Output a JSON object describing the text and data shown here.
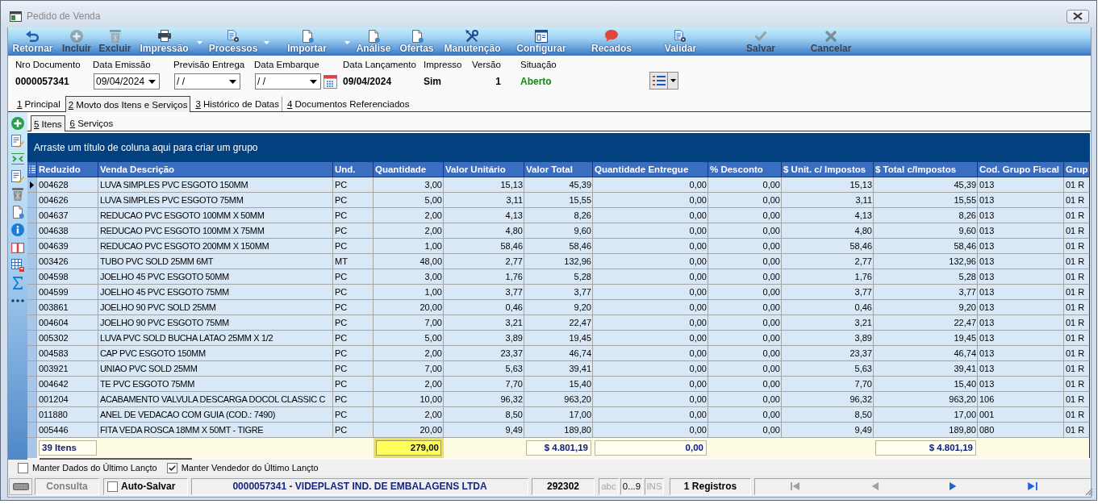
{
  "window": {
    "title": "Pedido de Venda"
  },
  "toolbar": [
    {
      "label": "Retornar",
      "disabled": false,
      "dropdown": false
    },
    {
      "label": "Incluir",
      "disabled": true,
      "dropdown": false
    },
    {
      "label": "Excluir",
      "disabled": true,
      "dropdown": false
    },
    {
      "label": "Impressão",
      "disabled": false,
      "dropdown": true
    },
    {
      "label": "Processos",
      "disabled": false,
      "dropdown": true
    },
    {
      "label": "Importar",
      "disabled": false,
      "dropdown": true
    },
    {
      "label": "Análise",
      "disabled": false,
      "dropdown": false
    },
    {
      "label": "Ofertas",
      "disabled": false,
      "dropdown": false
    },
    {
      "label": "Manutenção",
      "disabled": false,
      "dropdown": false
    },
    {
      "label": "Configurar",
      "disabled": false,
      "dropdown": false
    },
    {
      "label": "Recados",
      "disabled": false,
      "dropdown": false
    },
    {
      "label": "Validar",
      "disabled": false,
      "dropdown": false
    },
    {
      "label": "Salvar",
      "disabled": true,
      "dropdown": false
    },
    {
      "label": "Cancelar",
      "disabled": true,
      "dropdown": false
    }
  ],
  "header": {
    "fields": [
      {
        "kind": "text",
        "label": "Nro Documento",
        "value": "0000057341"
      },
      {
        "kind": "date",
        "label": "Data Emissão",
        "value": "09/04/2024"
      },
      {
        "kind": "date",
        "label": "Previsão Entrega",
        "value": "/ /"
      },
      {
        "kind": "date-calendar",
        "label": "Data Embarque",
        "value": "/ /"
      },
      {
        "kind": "text",
        "label": "Data Lançamento",
        "value": "09/04/2024"
      },
      {
        "kind": "text",
        "label": "Impresso",
        "value": "Sim"
      },
      {
        "kind": "text",
        "label": "Versão",
        "value": "1"
      },
      {
        "kind": "status",
        "label": "Situação",
        "value": "Aberto"
      }
    ]
  },
  "tabs": [
    {
      "label": "1 Principal",
      "selected": false
    },
    {
      "label": "2 Movto dos Itens e Serviços",
      "selected": true
    },
    {
      "label": "3 Histórico de Datas",
      "selected": false
    },
    {
      "label": "4 Documentos Referenciados",
      "selected": false
    }
  ],
  "subtabs": [
    {
      "label": "5 Itens",
      "selected": true
    },
    {
      "label": "6 Serviços",
      "selected": false
    }
  ],
  "grid": {
    "group_hint": "Arraste um título de coluna aqui para criar um grupo",
    "columns": [
      "Reduzido",
      "Venda Descrição",
      "Und.",
      "Quantidade",
      "Valor Unitário",
      "Valor Total",
      "Quantidade Entregue",
      "% Desconto",
      "$ Unit. c/ Impostos",
      "$ Total c/Impostos",
      "Cod. Grupo Fiscal",
      "Grup"
    ],
    "rows": [
      {
        "selected": true,
        "cells": [
          "004628",
          "LUVA SIMPLES PVC ESGOTO 150MM",
          "PC",
          "3,00",
          "15,13",
          "45,39",
          "0,00",
          "0,00",
          "15,13",
          "45,39",
          "013",
          "01 R"
        ]
      },
      {
        "selected": false,
        "cells": [
          "004626",
          "LUVA SIMPLES PVC ESGOTO 75MM",
          "PC",
          "5,00",
          "3,11",
          "15,55",
          "0,00",
          "0,00",
          "3,11",
          "15,55",
          "013",
          "01 R"
        ]
      },
      {
        "selected": false,
        "cells": [
          "004637",
          "REDUCAO PVC ESGOTO 100MM X 50MM",
          "PC",
          "2,00",
          "4,13",
          "8,26",
          "0,00",
          "0,00",
          "4,13",
          "8,26",
          "013",
          "01 R"
        ]
      },
      {
        "selected": false,
        "cells": [
          "004638",
          "REDUCAO PVC ESGOTO 100MM X 75MM",
          "PC",
          "2,00",
          "4,80",
          "9,60",
          "0,00",
          "0,00",
          "4,80",
          "9,60",
          "013",
          "01 R"
        ]
      },
      {
        "selected": false,
        "cells": [
          "004639",
          "REDUCAO PVC ESGOTO 200MM X 150MM",
          "PC",
          "1,00",
          "58,46",
          "58,46",
          "0,00",
          "0,00",
          "58,46",
          "58,46",
          "013",
          "01 R"
        ]
      },
      {
        "selected": false,
        "cells": [
          "003426",
          "TUBO PVC SOLD 25MM 6MT",
          "MT",
          "48,00",
          "2,77",
          "132,96",
          "0,00",
          "0,00",
          "2,77",
          "132,96",
          "013",
          "01 R"
        ]
      },
      {
        "selected": false,
        "cells": [
          "004598",
          "JOELHO 45 PVC ESGOTO 50MM",
          "PC",
          "3,00",
          "1,76",
          "5,28",
          "0,00",
          "0,00",
          "1,76",
          "5,28",
          "013",
          "01 R"
        ]
      },
      {
        "selected": false,
        "cells": [
          "004599",
          "JOELHO 45 PVC ESGOTO 75MM",
          "PC",
          "1,00",
          "3,77",
          "3,77",
          "0,00",
          "0,00",
          "3,77",
          "3,77",
          "013",
          "01 R"
        ]
      },
      {
        "selected": false,
        "cells": [
          "003861",
          "JOELHO 90 PVC SOLD 25MM",
          "PC",
          "20,00",
          "0,46",
          "9,20",
          "0,00",
          "0,00",
          "0,46",
          "9,20",
          "013",
          "01 R"
        ]
      },
      {
        "selected": false,
        "cells": [
          "004604",
          "JOELHO 90 PVC ESGOTO 75MM",
          "PC",
          "7,00",
          "3,21",
          "22,47",
          "0,00",
          "0,00",
          "3,21",
          "22,47",
          "013",
          "01 R"
        ]
      },
      {
        "selected": false,
        "cells": [
          "005302",
          "LUVA PVC SOLD BUCHA LATAO 25MM X 1/2",
          "PC",
          "5,00",
          "3,89",
          "19,45",
          "0,00",
          "0,00",
          "3,89",
          "19,45",
          "013",
          "01 R"
        ]
      },
      {
        "selected": false,
        "cells": [
          "004583",
          "CAP PVC ESGOTO 150MM",
          "PC",
          "2,00",
          "23,37",
          "46,74",
          "0,00",
          "0,00",
          "23,37",
          "46,74",
          "013",
          "01 R"
        ]
      },
      {
        "selected": false,
        "cells": [
          "003921",
          "UNIAO PVC SOLD 25MM",
          "PC",
          "7,00",
          "5,63",
          "39,41",
          "0,00",
          "0,00",
          "5,63",
          "39,41",
          "013",
          "01 R"
        ]
      },
      {
        "selected": false,
        "cells": [
          "004642",
          "TE PVC ESGOTO 75MM",
          "PC",
          "2,00",
          "7,70",
          "15,40",
          "0,00",
          "0,00",
          "7,70",
          "15,40",
          "013",
          "01 R"
        ]
      },
      {
        "selected": false,
        "cells": [
          "001204",
          "ACABAMENTO VALVULA DESCARGA DOCOL CLASSIC C",
          "PC",
          "10,00",
          "96,32",
          "963,20",
          "0,00",
          "0,00",
          "96,32",
          "963,20",
          "106",
          "01 R"
        ]
      },
      {
        "selected": false,
        "cells": [
          "011880",
          "ANEL DE VEDACAO COM GUIA (COD.: 7490)",
          "PC",
          "2,00",
          "8,50",
          "17,00",
          "0,00",
          "0,00",
          "8,50",
          "17,00",
          "001",
          "01 R"
        ]
      },
      {
        "selected": false,
        "cells": [
          "005446",
          "FITA VEDA ROSCA 18MM X 50MT - TIGRE",
          "PC",
          "20,00",
          "9,49",
          "189,80",
          "0,00",
          "0,00",
          "9,49",
          "189,80",
          "080",
          "01 R"
        ]
      }
    ],
    "totals": [
      {
        "text": "39 Itens",
        "highlighted": false
      },
      {
        "text": "279,00",
        "highlighted": true
      },
      {
        "text": "$ 4.801,19",
        "highlighted": false
      },
      {
        "text": "0,00",
        "highlighted": false
      },
      {
        "text": "$ 4.801,19",
        "highlighted": false
      }
    ]
  },
  "options": [
    {
      "label": "Manter Dados do Último Lançto",
      "checked": false
    },
    {
      "label": "Manter Vendedor do Último Lançto",
      "checked": true
    }
  ],
  "status_bar": {
    "mode": "Consulta",
    "autosave": {
      "label": "Auto-Salvar",
      "checked": false
    },
    "record": "0000057341 - VIDEPLAST IND. DE EMBALAGENS LTDA",
    "code": "292302",
    "indicators": [
      {
        "label": "abc",
        "on": false
      },
      {
        "label": "0...9",
        "on": true
      },
      {
        "label": "INS",
        "on": false
      }
    ],
    "count": "1 Registros",
    "navigation": [
      {
        "disabled": true
      },
      {
        "disabled": true
      },
      {
        "disabled": false
      },
      {
        "disabled": false
      }
    ]
  }
}
